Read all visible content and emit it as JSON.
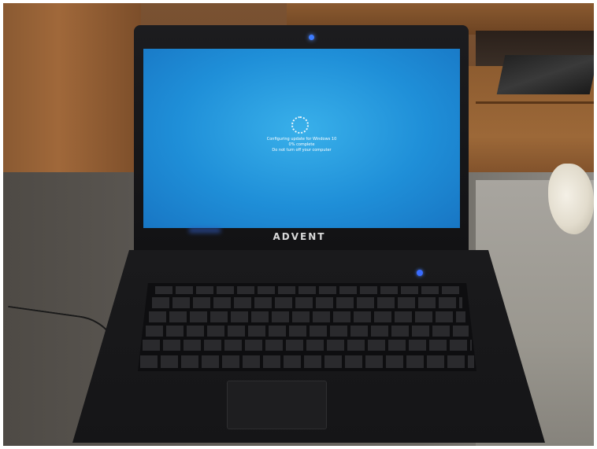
{
  "screen": {
    "line1": "Configuring update for Windows 10",
    "line2": "0% complete",
    "line3": "Do not turn off your computer"
  },
  "laptop": {
    "brand": "ADVENT"
  },
  "colors": {
    "screen_blue": "#1f8fd8",
    "led_blue": "#3d7cff"
  }
}
